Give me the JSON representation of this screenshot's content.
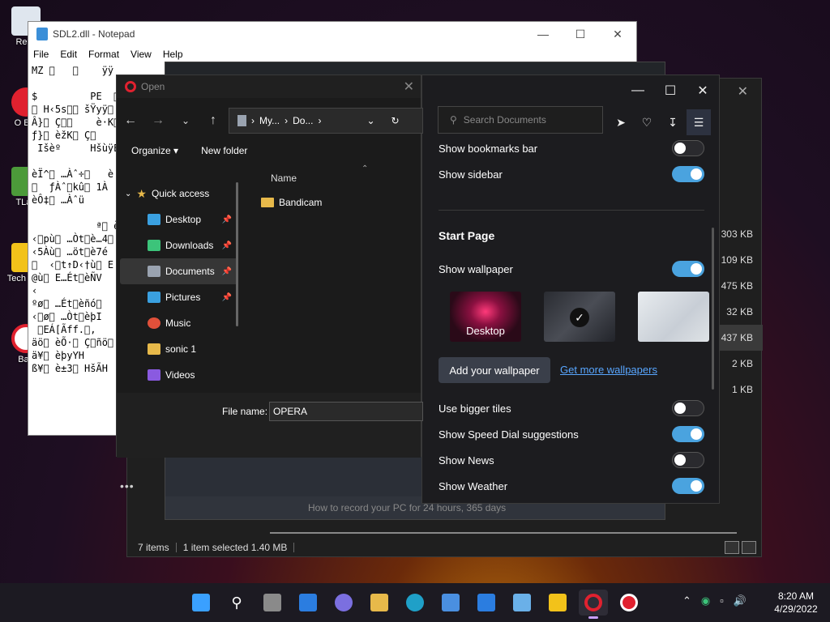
{
  "desktop": {
    "icons": [
      {
        "label": "Recy"
      },
      {
        "label": "O Bro"
      },
      {
        "label": "TLau"
      },
      {
        "label": "Tech Cap"
      },
      {
        "label": "Ban"
      }
    ]
  },
  "notepad": {
    "title": "SDL2.dll - Notepad",
    "menu": [
      "File",
      "Edit",
      "Format",
      "View",
      "Help"
    ],
    "content": "MZ \u0000   \u0000    ÿÿ\n\n$         PE  \u0000\n\u0000 H‹5s\u0000\u0000 šŸyÿ\u0000\nÂ}\u0000 Ç\u0000\u0000    è·K\u0000\nƒ}\u0000 èžK\u0000 Ç\u0000\n Išèº     HšùÿE\n                  é\nèÏ^\u0000 …Àˆ÷\u0000   è\n\u0000  ƒÀˆ\u0000kû\u0000 1À\nèÔ‡\u0000 …Àˆü\n\n           ª\u0000 èÃ\n‹\u0000pù\u0000 …Òt\u0000è…4\u0000\n‹5Àù\u0000 …öt\u0000è7é\n\u0000  ‹\u0000t↑D‹†ù\u0000 E\n@ù\u0000 E…Ét\u0000èÑV\n‹\nºø\u0000 …Ét\u0000èñó\u0000\n‹\u0000ø\u0000 …Òt\u0000èþI\n \u0000EÁ[Ãff.\u0000,\näö\u0000 èÕ·\u0000 Ç\u0000ñö\u0000\nä¥\u0000 èþyYH\nß¥\u0000 è±3\u0000 HšÃH"
  },
  "bandicam": {
    "footer": "How to record your PC for 24 hours, 365 days"
  },
  "explorer_back": {
    "status": [
      "7 items",
      "1 item selected  1.40 MB"
    ],
    "sizes": [
      "303 KB",
      "109 KB",
      "475 KB",
      "32 KB",
      "437 KB",
      "2 KB",
      "1 KB"
    ]
  },
  "open_dialog": {
    "title": "Open",
    "address": [
      "My...",
      "Do..."
    ],
    "search_placeholder": "Search Documents",
    "commands": {
      "organize": "Organize ▾",
      "new_folder": "New folder"
    },
    "nav": {
      "quick_access": "Quick access",
      "items": [
        {
          "label": "Desktop",
          "color": "#3aa0e0",
          "pinned": true
        },
        {
          "label": "Downloads",
          "color": "#3cc47a",
          "pinned": true
        },
        {
          "label": "Documents",
          "color": "#9aa3b0",
          "pinned": true
        },
        {
          "label": "Pictures",
          "color": "#3aa0e0",
          "pinned": true
        },
        {
          "label": "Music",
          "color": "#e0503a",
          "pinned": false
        },
        {
          "label": "sonic 1",
          "color": "#e7b94a",
          "pinned": false
        },
        {
          "label": "Videos",
          "color": "#8a5ae0",
          "pinned": false
        }
      ]
    },
    "column_header": "Name",
    "files": [
      "Bandicam"
    ],
    "filename_label": "File name:",
    "filename_value": "OPERA"
  },
  "opera_settings": {
    "rows_top": [
      {
        "label": "Show bookmarks bar",
        "on": false
      },
      {
        "label": "Show sidebar",
        "on": true
      }
    ],
    "start_page_heading": "Start Page",
    "show_wallpaper": {
      "label": "Show wallpaper",
      "on": true
    },
    "wallpapers": [
      {
        "label": "Desktop"
      },
      {
        "label": ""
      },
      {
        "label": ""
      }
    ],
    "add_wallpaper": "Add your wallpaper",
    "get_more": "Get more wallpapers",
    "rows_bottom": [
      {
        "label": "Use bigger tiles",
        "on": false
      },
      {
        "label": "Show Speed Dial suggestions",
        "on": true
      },
      {
        "label": "Show News",
        "on": false
      },
      {
        "label": "Show Weather",
        "on": true
      }
    ]
  },
  "taskbar": {
    "clock_time": "8:20 AM",
    "clock_date": "4/29/2022",
    "apps": [
      {
        "name": "start-icon",
        "color": "#3aa0ff"
      },
      {
        "name": "search-icon",
        "color": "transparent"
      },
      {
        "name": "task-view-icon",
        "color": "#8a8a8a"
      },
      {
        "name": "widgets-icon",
        "color": "#2b7de0"
      },
      {
        "name": "chat-icon",
        "color": "#7b6fe0"
      },
      {
        "name": "file-explorer-icon",
        "color": "#e7b94a"
      },
      {
        "name": "edge-icon",
        "color": "#1fa0c8"
      },
      {
        "name": "store-icon",
        "color": "#4a8fe0"
      },
      {
        "name": "mail-icon",
        "color": "#2b7de0"
      },
      {
        "name": "notepad-icon",
        "color": "#6ab0e8"
      },
      {
        "name": "bandicam-app-icon",
        "color": "#f2c21a"
      },
      {
        "name": "opera-icon",
        "color": "#e0212f"
      },
      {
        "name": "record-icon",
        "color": "#e0212f"
      }
    ]
  }
}
